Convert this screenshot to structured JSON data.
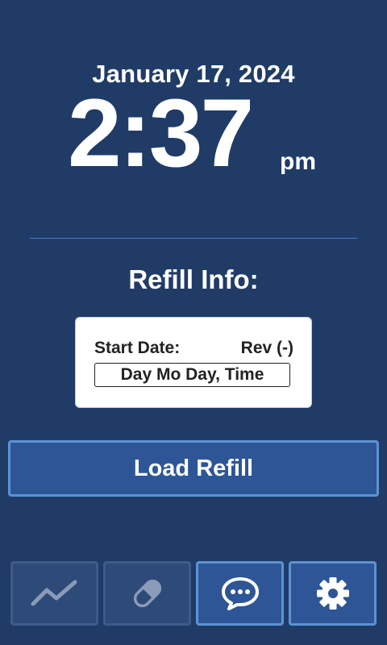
{
  "clock": {
    "date": "January 17, 2024",
    "time": "2:37",
    "ampm": "pm"
  },
  "refill": {
    "title": "Refill Info:",
    "start_label": "Start Date:",
    "rev_label": "Rev (-)",
    "start_value": "Day Mo Day, Time"
  },
  "actions": {
    "load_refill_label": "Load Refill"
  },
  "bottom_nav": [
    {
      "icon": "chart-icon",
      "state": "disabled"
    },
    {
      "icon": "pill-icon",
      "state": "disabled"
    },
    {
      "icon": "chat-icon",
      "state": "active"
    },
    {
      "icon": "gear-icon",
      "state": "active"
    }
  ],
  "colors": {
    "background": "#213b67",
    "button": "#2e5696",
    "button_border": "#5b93d6",
    "divider": "#4a7cc2",
    "disabled_icon": "#8a9bb8"
  }
}
